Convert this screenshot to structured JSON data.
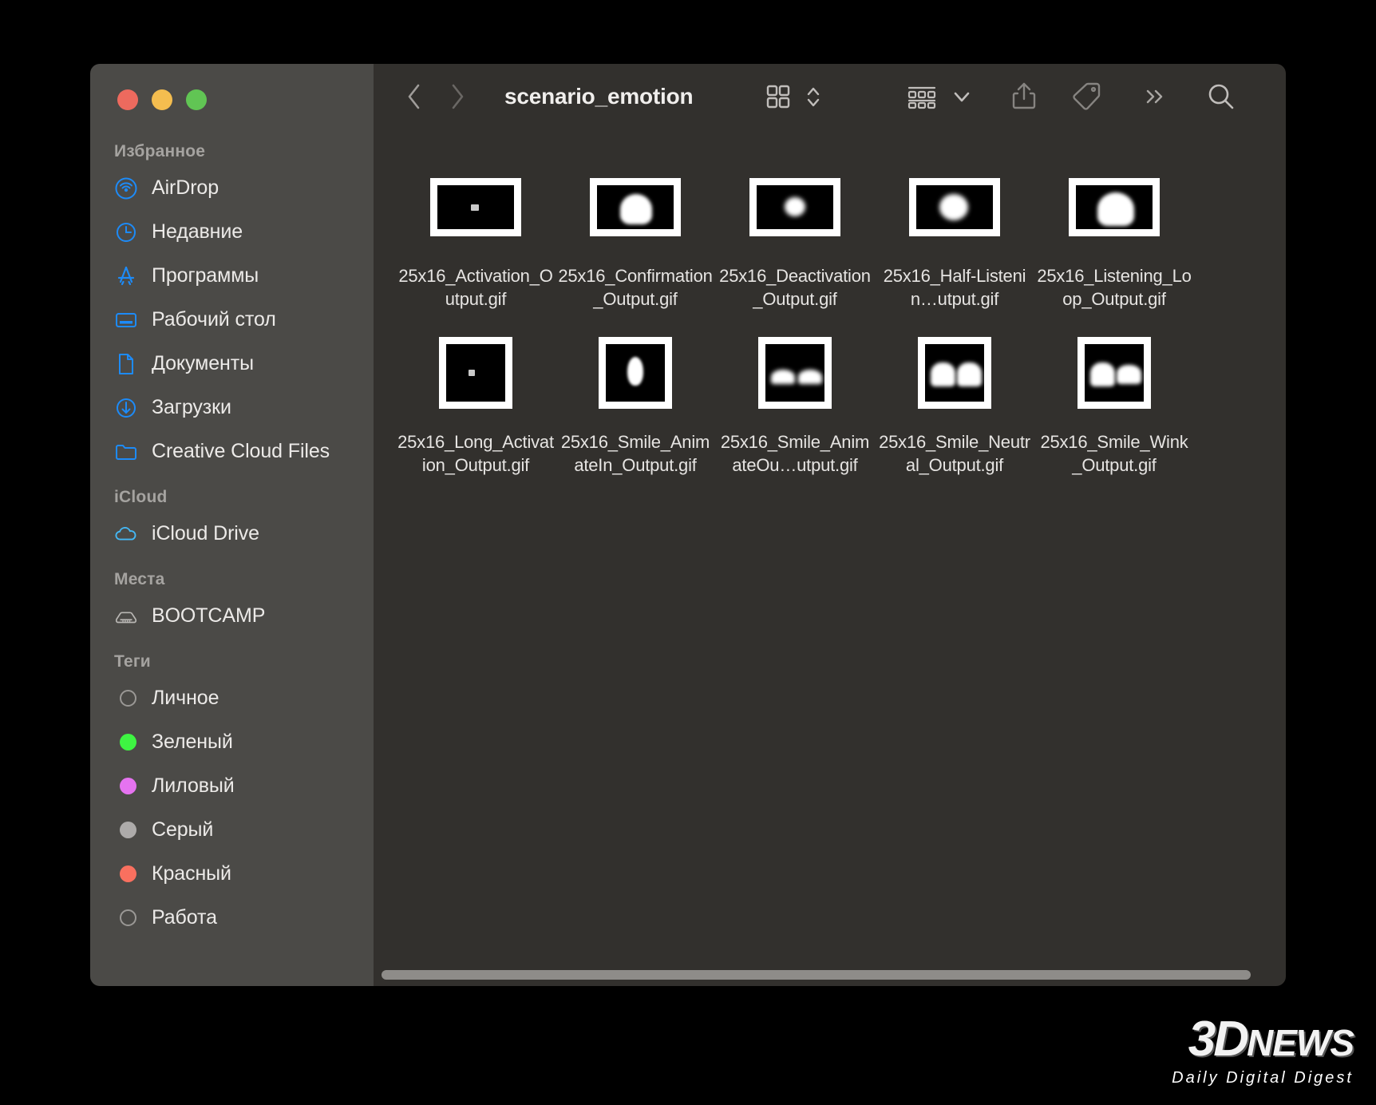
{
  "window": {
    "title": "scenario_emotion",
    "traffic_lights": [
      {
        "name": "close",
        "color": "#ed6a5e"
      },
      {
        "name": "minimize",
        "color": "#f4bd4f"
      },
      {
        "name": "zoom",
        "color": "#61c554"
      }
    ]
  },
  "toolbar": {
    "back_label": "‹",
    "forward_label": "›",
    "title": "scenario_emotion",
    "icons": [
      "grid-view-icon",
      "sort-chevrons-icon",
      "group-view-icon",
      "chevron-down-icon",
      "share-icon",
      "tag-icon",
      "more-chevrons-icon",
      "search-icon"
    ]
  },
  "sidebar": {
    "sections": [
      {
        "title": "Избранное",
        "items": [
          {
            "label": "AirDrop",
            "icon": "airdrop-icon"
          },
          {
            "label": "Недавние",
            "icon": "clock-icon"
          },
          {
            "label": "Программы",
            "icon": "applications-icon"
          },
          {
            "label": "Рабочий стол",
            "icon": "desktop-icon"
          },
          {
            "label": "Документы",
            "icon": "document-icon"
          },
          {
            "label": "Загрузки",
            "icon": "downloads-icon"
          },
          {
            "label": "Creative Cloud Files",
            "icon": "folder-icon"
          }
        ]
      },
      {
        "title": "iCloud",
        "items": [
          {
            "label": "iCloud Drive",
            "icon": "cloud-icon"
          }
        ]
      },
      {
        "title": "Места",
        "items": [
          {
            "label": "BOOTCAMP",
            "icon": "harddisk-icon"
          }
        ]
      },
      {
        "title": "Теги",
        "items": [
          {
            "label": "Личное",
            "icon": "tag-dot-icon",
            "color": "none"
          },
          {
            "label": "Зеленый",
            "icon": "tag-dot-icon",
            "color": "#3ef442"
          },
          {
            "label": "Лиловый",
            "icon": "tag-dot-icon",
            "color": "#e573f0"
          },
          {
            "label": "Серый",
            "icon": "tag-dot-icon",
            "color": "#adabaa"
          },
          {
            "label": "Красный",
            "icon": "tag-dot-icon",
            "color": "#f9705f"
          },
          {
            "label": "Работа",
            "icon": "tag-dot-icon",
            "color": "none"
          }
        ]
      }
    ]
  },
  "files": [
    {
      "name": "25x16_Activation_Output.gif",
      "shape": "wide",
      "preview": "tiny-dot"
    },
    {
      "name": "25x16_Confirmation_Output.gif",
      "shape": "wide",
      "preview": "dome"
    },
    {
      "name": "25x16_Deactivation_Output.gif",
      "shape": "wide",
      "preview": "small-blob"
    },
    {
      "name": "25x16_Half-Listenin…utput.gif",
      "shape": "wide",
      "preview": "blob"
    },
    {
      "name": "25x16_Listening_Loop_Output.gif",
      "shape": "wide",
      "preview": "big-dome"
    },
    {
      "name": "25x16_Long_Activation_Output.gif",
      "shape": "tall",
      "preview": "tiny-dot"
    },
    {
      "name": "25x16_Smile_AnimateIn_Output.gif",
      "shape": "tall",
      "preview": "teardrop"
    },
    {
      "name": "25x16_Smile_AnimateOu…utput.gif",
      "shape": "tall",
      "preview": "two-small-eyes"
    },
    {
      "name": "25x16_Smile_Neutral_Output.gif",
      "shape": "tall",
      "preview": "two-eyes"
    },
    {
      "name": "25x16_Smile_Wink_Output.gif",
      "shape": "tall",
      "preview": "two-eyes-wink"
    }
  ],
  "watermark": {
    "logo": "3D",
    "logo_suffix": "NEWS",
    "tagline": "Daily Digital Digest"
  }
}
